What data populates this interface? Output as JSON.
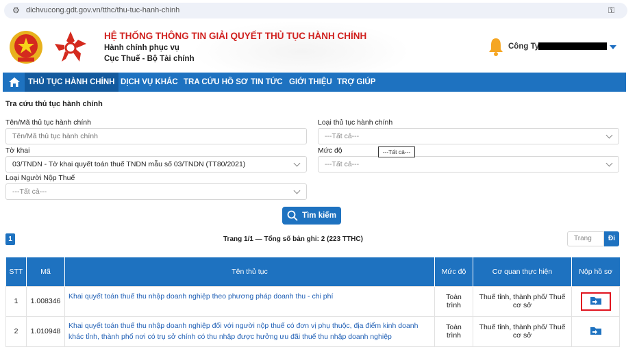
{
  "browser": {
    "url": "dichvucong.gdt.gov.vn/tthc/thu-tuc-hanh-chinh"
  },
  "header": {
    "title": "HỆ THỐNG THÔNG TIN GIẢI QUYẾT THỦ TỤC HÀNH CHÍNH",
    "sub1": "Hành chính phục vụ",
    "sub2": "Cục Thuế - Bộ Tài chính",
    "company": "Công Ty"
  },
  "nav": {
    "items": [
      "THỦ TỤC HÀNH CHÍNH",
      "DỊCH VỤ KHÁC",
      "TRA CỨU HỒ SƠ",
      "TIN TỨC",
      "GIỚI THIỆU",
      "TRỢ GIÚP"
    ]
  },
  "form": {
    "section_title": "Tra cứu thủ tục hành chính",
    "name_label": "Tên/Mã thủ tục hành chính",
    "name_placeholder": "Tên/Mã thủ tục hành chính",
    "type_label": "Loại thủ tục hành chính",
    "type_value": "---Tất cả---",
    "form_label": "Tờ khai",
    "form_value": "03/TNDN - Tờ khai quyết toán thuế TNDN mẫu số 03/TNDN (TT80/2021)",
    "level_label": "Mức độ",
    "level_value": "---Tất cả---",
    "taxpayer_label": "Loại Người Nộp Thuế",
    "taxpayer_value": "---Tất cả---",
    "tooltip": "---Tất cả---",
    "search_button": "Tìm kiếm"
  },
  "pagination": {
    "current": "1",
    "info": "Trang 1/1 — Tổng số bản ghi: 2 (223 TTHC)",
    "page_placeholder": "Trang",
    "go_label": "Đi"
  },
  "table": {
    "headers": [
      "STT",
      "Mã",
      "Tên thủ tục",
      "Mức độ",
      "Cơ quan thực hiện",
      "Nộp hồ sơ"
    ],
    "rows": [
      {
        "stt": "1",
        "code": "1.008346",
        "name": "Khai quyết toán thuế thu nhập doanh nghiệp theo phương pháp doanh thu - chi phí",
        "level": "Toàn trình",
        "agency": "Thuế tỉnh, thành phố/ Thuế cơ sở"
      },
      {
        "stt": "2",
        "code": "1.010948",
        "name": "Khai quyết toán thuế thu nhập doanh nghiệp đối với người nộp thuế có đơn vị phụ thuộc, địa điểm kinh doanh khác tỉnh, thành phố nơi có trụ sở chính có thu nhập được hưởng ưu đãi thuế thu nhập doanh nghiệp",
        "level": "Toàn trình",
        "agency": "Thuế tỉnh, thành phố/ Thuế cơ sở"
      }
    ]
  },
  "colors": {
    "primary": "#1e72c0",
    "title_red": "#d0201e",
    "link": "#1f5fb5",
    "highlight": "#e0141e"
  }
}
